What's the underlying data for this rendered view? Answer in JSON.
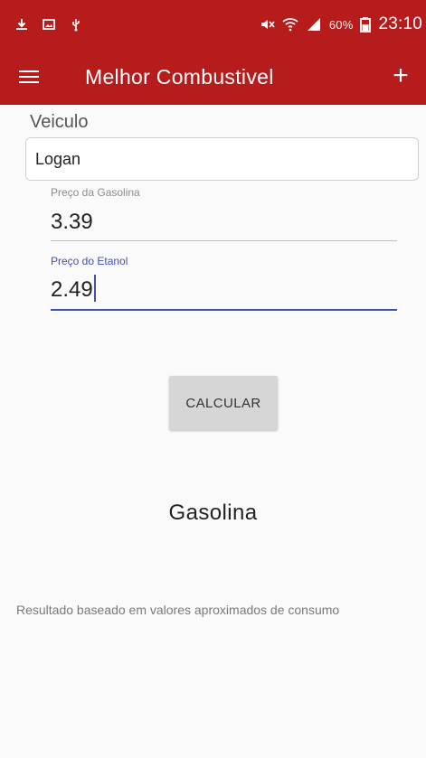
{
  "status_bar": {
    "icons": [
      "download-icon",
      "image-icon",
      "usb-icon",
      "mute-icon",
      "wifi-icon",
      "signal-icon",
      "battery-icon"
    ],
    "battery": "60%",
    "time": "23:10",
    "color": "#b71c1c"
  },
  "toolbar": {
    "title": "Melhor Combustivel",
    "add_label": "+",
    "color": "#b71c1c"
  },
  "form": {
    "vehicle_label": "Veiculo",
    "vehicle_value": "Logan",
    "gasoline_label": "Preço da Gasolina",
    "gasoline_value": "3.39",
    "ethanol_label": "Preço do Etanol",
    "ethanol_value": "2.49",
    "accent_color": "#3f51b5"
  },
  "actions": {
    "calculate_label": "CALCULAR"
  },
  "result": {
    "value": "Gasolina",
    "note": "Resultado baseado em valores aproximados de consumo"
  }
}
